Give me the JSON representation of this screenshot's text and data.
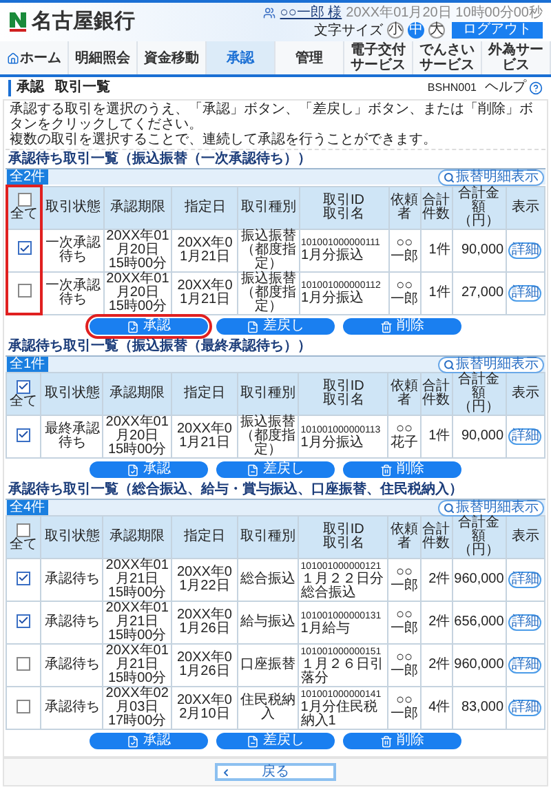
{
  "header": {
    "bank_name": "名古屋銀行",
    "user": "○○一郎 様",
    "datetime": "20XX年01月20日 10時00分00秒",
    "font_size_label": "文字サイズ",
    "font_sizes": [
      {
        "label": "小",
        "selected": false
      },
      {
        "label": "中",
        "selected": true
      },
      {
        "label": "大",
        "selected": false
      }
    ],
    "logout": "ログアウト"
  },
  "nav": [
    {
      "label": "ホーム",
      "kind": "home",
      "selected": false
    },
    {
      "label": "明細照会",
      "kind": "text",
      "selected": false
    },
    {
      "label": "資金移動",
      "kind": "text",
      "selected": false
    },
    {
      "label": "承認",
      "kind": "text",
      "selected": true
    },
    {
      "label": "管理",
      "kind": "text",
      "selected": false
    },
    {
      "label": "電子交付サービス",
      "kind": "text",
      "selected": false
    },
    {
      "label": "でんさいサービス",
      "kind": "text",
      "selected": false
    },
    {
      "label": "外為サービス",
      "kind": "text",
      "selected": false
    }
  ],
  "page": {
    "category": "承認",
    "title": "取引一覧",
    "screen_id": "BSHN001",
    "help": "ヘルプ"
  },
  "instructions": [
    "承認する取引を選択のうえ、「承認」ボタン、「差戻し」ボタン、または「削除」ボタンをクリックしてください。",
    "複数の取引を選択することで、連続して承認を行うことができます。"
  ],
  "tables": [
    {
      "title": "承認待ち取引一覧（振込振替（一次承認待ち））",
      "count": "全2件",
      "expand": "振替明細表示",
      "highlight_select": true,
      "select_all": {
        "label": "全て",
        "checked": false
      },
      "columns": [
        "取引状態",
        "承認期限",
        "指定日",
        "取引種別",
        "取引ID\n取引名",
        "依頼者",
        "合計件数",
        "合計金額（円）",
        "表示"
      ],
      "rows": [
        {
          "checked": true,
          "status": "一次承認待ち",
          "deadline_date": "20XX年01月20日",
          "deadline_time": "15時00分",
          "date": "20XX年01月21日",
          "type": "振込振替（都度指定）",
          "id": "101001000000111",
          "name": "1月分振込",
          "requester": "○○一郎",
          "count": "1件",
          "amount": "90,000",
          "detail": "詳細"
        },
        {
          "checked": false,
          "status": "一次承認待ち",
          "deadline_date": "20XX年01月20日",
          "deadline_time": "15時00分",
          "date": "20XX年01月21日",
          "type": "振込振替（都度指定）",
          "id": "101001000000112",
          "name": "1月分振込",
          "requester": "○○一郎",
          "count": "1件",
          "amount": "27,000",
          "detail": "詳細"
        }
      ],
      "buttons": [
        {
          "label": "承認",
          "kind": "approve",
          "highlighted": true
        },
        {
          "label": "差戻し",
          "kind": "return",
          "highlighted": false
        },
        {
          "label": "削除",
          "kind": "delete",
          "highlighted": false
        }
      ]
    },
    {
      "title": "承認待ち取引一覧（振込振替（最終承認待ち））",
      "count": "全1件",
      "expand": "振替明細表示",
      "highlight_select": false,
      "select_all": {
        "label": "全て",
        "checked": true
      },
      "columns": [
        "取引状態",
        "承認期限",
        "指定日",
        "取引種別",
        "取引ID\n取引名",
        "依頼者",
        "合計件数",
        "合計金額（円）",
        "表示"
      ],
      "rows": [
        {
          "checked": true,
          "status": "最終承認待ち",
          "deadline_date": "20XX年01月20日",
          "deadline_time": "15時00分",
          "date": "20XX年01月21日",
          "type": "振込振替（都度指定）",
          "id": "101001000000113",
          "name": "1月分振込",
          "requester": "○○花子",
          "count": "1件",
          "amount": "90,000",
          "detail": "詳細"
        }
      ],
      "buttons": [
        {
          "label": "承認",
          "kind": "approve",
          "highlighted": false
        },
        {
          "label": "差戻し",
          "kind": "return",
          "highlighted": false
        },
        {
          "label": "削除",
          "kind": "delete",
          "highlighted": false
        }
      ]
    },
    {
      "title": "承認待ち取引一覧（総合振込、給与・賞与振込、口座振替、住民税納入）",
      "count": "全4件",
      "expand": "振替明細表示",
      "highlight_select": false,
      "select_all": {
        "label": "全て",
        "checked": false
      },
      "columns": [
        "取引状態",
        "承認期限",
        "指定日",
        "取引種別",
        "取引ID\n取引名",
        "依頼者",
        "合計件数",
        "合計金額（円）",
        "表示"
      ],
      "rows": [
        {
          "checked": true,
          "status": "承認待ち",
          "deadline_date": "20XX年01月21日",
          "deadline_time": "15時00分",
          "date": "20XX年01月22日",
          "type": "総合振込",
          "id": "101001000000121",
          "name": "１月２２日分総合振込",
          "requester": "○○一郎",
          "count": "2件",
          "amount": "960,000",
          "detail": "詳細"
        },
        {
          "checked": true,
          "status": "承認待ち",
          "deadline_date": "20XX年01月21日",
          "deadline_time": "15時00分",
          "date": "20XX年01月26日",
          "type": "給与振込",
          "id": "101001000000131",
          "name": "1月給与",
          "requester": "○○一郎",
          "count": "2件",
          "amount": "656,000",
          "detail": "詳細"
        },
        {
          "checked": false,
          "status": "承認待ち",
          "deadline_date": "20XX年01月21日",
          "deadline_time": "15時00分",
          "date": "20XX年01月26日",
          "type": "口座振替",
          "id": "101001000000151",
          "name": "１月２６日引落分",
          "requester": "○○一郎",
          "count": "2件",
          "amount": "960,000",
          "detail": "詳細"
        },
        {
          "checked": false,
          "status": "承認待ち",
          "deadline_date": "20XX年02月03日",
          "deadline_time": "17時00分",
          "date": "20XX年02月10日",
          "type": "住民税納入",
          "id": "101001000000141",
          "name": "1月分住民税納入1",
          "requester": "○○一郎",
          "count": "4件",
          "amount": "83,000",
          "detail": "詳細"
        }
      ],
      "buttons": [
        {
          "label": "承認",
          "kind": "approve",
          "highlighted": false
        },
        {
          "label": "差戻し",
          "kind": "return",
          "highlighted": false
        },
        {
          "label": "削除",
          "kind": "delete",
          "highlighted": false
        }
      ]
    }
  ],
  "back": {
    "label": "戻る"
  }
}
